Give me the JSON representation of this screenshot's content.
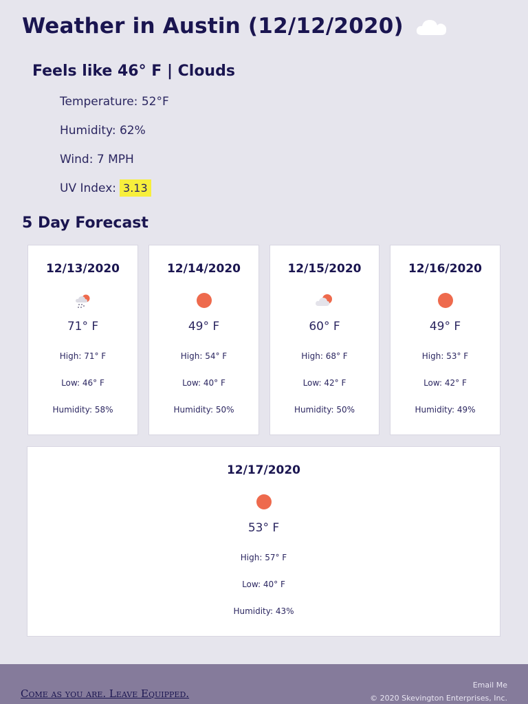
{
  "header": {
    "title": "Weather in Austin (12/12/2020)",
    "icon": "cloud-icon",
    "feels_like": "Feels like 46° F | Clouds"
  },
  "current": {
    "temperature_label": "Temperature:",
    "temperature_value": "52°F",
    "humidity_label": "Humidity:",
    "humidity_value": "62%",
    "wind_label": "Wind:",
    "wind_value": "7 MPH",
    "uv_label": "UV Index:",
    "uv_value": "3.13"
  },
  "forecast": {
    "title": "5 Day Forecast",
    "days": [
      {
        "date": "12/13/2020",
        "icon": "rain-icon",
        "temp": "71° F",
        "high": "High: 71° F",
        "low": "Low: 46° F",
        "humidity": "Humidity: 58%"
      },
      {
        "date": "12/14/2020",
        "icon": "sun-icon",
        "temp": "49° F",
        "high": "High: 54° F",
        "low": "Low: 40° F",
        "humidity": "Humidity: 50%"
      },
      {
        "date": "12/15/2020",
        "icon": "partly-cloudy-icon",
        "temp": "60° F",
        "high": "High: 68° F",
        "low": "Low: 42° F",
        "humidity": "Humidity: 50%"
      },
      {
        "date": "12/16/2020",
        "icon": "sun-icon",
        "temp": "49° F",
        "high": "High: 53° F",
        "low": "Low: 42° F",
        "humidity": "Humidity: 49%"
      },
      {
        "date": "12/17/2020",
        "icon": "sun-icon",
        "temp": "53° F",
        "high": "High: 57° F",
        "low": "Low: 40° F",
        "humidity": "Humidity: 43%"
      }
    ]
  },
  "footer": {
    "tagline": "Come as you are. Leave Equipped.",
    "email_link": "Email Me",
    "copyright": "© 2020 Skevington Enterprises, Inc."
  },
  "colors": {
    "background": "#e6e5ed",
    "heading": "#1a1550",
    "sun": "#ee6a4d",
    "uv_highlight": "#f7ef3c",
    "footer": "#857b9b"
  }
}
